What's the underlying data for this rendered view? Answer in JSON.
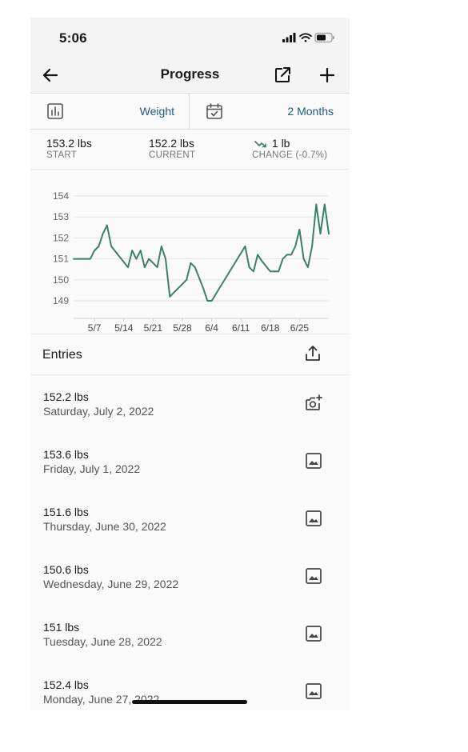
{
  "status_bar": {
    "time": "5:06"
  },
  "header": {
    "title": "Progress"
  },
  "filters": {
    "metric": "Weight",
    "range": "2 Months"
  },
  "stats": {
    "start": {
      "value": "153.2 lbs",
      "label": "START"
    },
    "current": {
      "value": "152.2 lbs",
      "label": "CURRENT"
    },
    "change": {
      "value": "1 lb",
      "label": "CHANGE (-0.7%)"
    }
  },
  "chart_data": {
    "type": "line",
    "ylim": [
      148,
      154.5
    ],
    "y_ticks": [
      "154",
      "153",
      "152",
      "151",
      "150",
      "149"
    ],
    "x_ticks": [
      "5/7",
      "5/14",
      "5/21",
      "5/28",
      "6/4",
      "6/11",
      "6/18",
      "6/25"
    ],
    "line_color": "#3d7f64",
    "series": [
      {
        "x": [
          "5/2",
          "5/6",
          "5/7",
          "5/8",
          "5/9",
          "5/10",
          "5/11",
          "5/15",
          "5/16",
          "5/17",
          "5/18",
          "5/19",
          "5/20",
          "5/21",
          "5/22",
          "5/23",
          "5/24",
          "5/25",
          "5/29",
          "5/30",
          "5/31",
          "6/2",
          "6/3",
          "6/4",
          "6/12",
          "6/13",
          "6/14",
          "6/15",
          "6/16",
          "6/18",
          "6/19",
          "6/20",
          "6/21",
          "6/22",
          "6/23",
          "6/24",
          "6/25",
          "6/26",
          "6/27",
          "6/28",
          "6/29",
          "6/30",
          "7/1",
          "7/2"
        ],
        "y": [
          151.0,
          151.0,
          151.4,
          151.6,
          152.2,
          152.6,
          151.6,
          150.6,
          151.4,
          151.0,
          151.4,
          150.6,
          151.0,
          150.8,
          150.6,
          151.6,
          151.0,
          149.2,
          150.0,
          150.8,
          150.6,
          149.6,
          149.0,
          149.0,
          151.6,
          150.6,
          150.4,
          151.2,
          150.9,
          150.4,
          150.4,
          150.4,
          151.0,
          151.2,
          151.2,
          151.6,
          152.4,
          151.0,
          150.6,
          151.6,
          153.6,
          152.2,
          153.6,
          152.2
        ]
      }
    ]
  },
  "entries": {
    "title": "Entries",
    "items": [
      {
        "weight": "152.2 lbs",
        "date": "Saturday, July 2, 2022",
        "icon": "add-photo-icon"
      },
      {
        "weight": "153.6 lbs",
        "date": "Friday, July 1, 2022",
        "icon": "image-icon"
      },
      {
        "weight": "151.6 lbs",
        "date": "Thursday, June 30, 2022",
        "icon": "image-icon"
      },
      {
        "weight": "150.6 lbs",
        "date": "Wednesday, June 29, 2022",
        "icon": "image-icon"
      },
      {
        "weight": "151 lbs",
        "date": "Tuesday, June 28, 2022",
        "icon": "image-icon"
      },
      {
        "weight": "152.4 lbs",
        "date": "Monday, June 27, 2022",
        "icon": "image-icon"
      }
    ]
  }
}
